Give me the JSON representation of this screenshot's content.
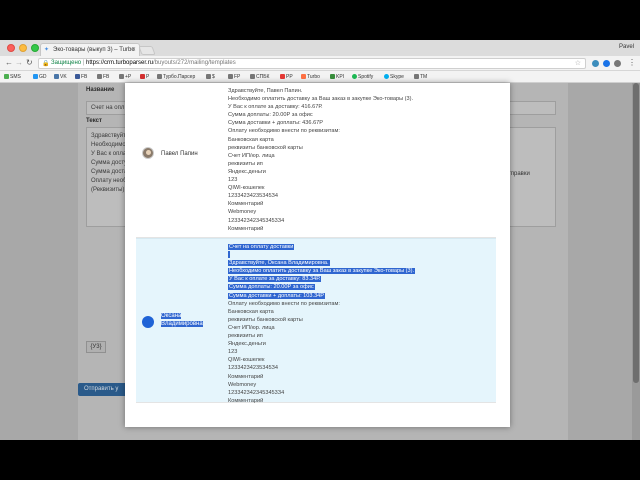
{
  "browser": {
    "tab_title": "Эко-товары (выкуп 3) – Turbo",
    "profile_name": "Pavel",
    "secure_label": "Защищено",
    "url_domain": "https://crm.turboparser.ru",
    "url_path": "/buyouts/272/mailing/templates",
    "bookmarks": [
      {
        "label": "SMS",
        "color": "#4caf50"
      },
      {
        "label": "GD",
        "color": "#2196f3"
      },
      {
        "label": "VK",
        "color": "#4a76a8"
      },
      {
        "label": "FB",
        "color": "#3b5998"
      },
      {
        "label": "FB",
        "color": "#777777"
      },
      {
        "label": "+P",
        "color": "#777777"
      },
      {
        "label": "P",
        "color": "#d32f2f"
      },
      {
        "label": "Турбо.Парсер",
        "color": "#777777"
      },
      {
        "label": "$",
        "color": "#777777"
      },
      {
        "label": "FP",
        "color": "#777777"
      },
      {
        "label": "СПБК",
        "color": "#777777"
      },
      {
        "label": "PP",
        "color": "#e53935"
      },
      {
        "label": "Turbo",
        "color": "#ff7043"
      },
      {
        "label": "KPI",
        "color": "#388e3c"
      },
      {
        "label": "Spotify",
        "color": "#1db954"
      },
      {
        "label": "Skype",
        "color": "#00aff0"
      },
      {
        "label": "TM",
        "color": "#777777"
      }
    ]
  },
  "background": {
    "label_name": "Название",
    "input_name_text": "Счет на опл",
    "label_text": "Текст",
    "text_lines": [
      "Здравствуйте",
      "Необходимо",
      "У Вас к опла",
      "Сумма досту",
      "Сумма доста",
      "Оплату необ",
      "(Реквизиты)"
    ],
    "chip_label": "{У3}",
    "send_button": "Отправить у",
    "side_text": "тправки"
  },
  "modal": {
    "rows": [
      {
        "name": "Павел Папин",
        "lines": [
          "Здравствуйте, Павел Папин.",
          "Необходимо оплатить доставку за Ваш заказ в закупке Эко-товары (3).",
          "У Вас к оплате за доставку: 416.67Р.",
          "Сумма доплаты: 20.00Р за офис",
          "Сумма доставки + доплаты: 436.67Р",
          "Оплату необходимо внести по реквизитам:",
          "Банковская карта",
          "реквизиты банковской карты",
          "Счет ИП/юр. лица",
          "реквизиты ип",
          "Яндекс.деньги",
          "123",
          "QIWI-кошелек",
          "12334234235345З4",
          "Комментарий",
          "Webmoney",
          "1233423423453453З4",
          "Комментарий"
        ]
      },
      {
        "name": "Оксана Владимировна",
        "lines": [
          "Счет на оплату доставки",
          "",
          "Здравствуйте, Оксана Владимировна.",
          "Необходимо оплатить доставку за Ваш заказ в закупке Эко-товары (3).",
          "У Вас к оплате за доставку: 83.34Р.",
          "Сумма доплаты: 20.00Р за офис",
          "Сумма доставки + доплаты: 103.34Р",
          "Оплату необходимо внести по реквизитам:",
          "Банковская карта",
          "реквизиты банковской карты",
          "Счет ИП/юр. лица",
          "реквизиты ип",
          "Яндекс.деньги",
          "123",
          "QIWI-кошелек",
          "12334234235345З4",
          "Комментарий",
          "Webmoney",
          "1233423423453453З4",
          "Комментарий"
        ]
      }
    ]
  }
}
